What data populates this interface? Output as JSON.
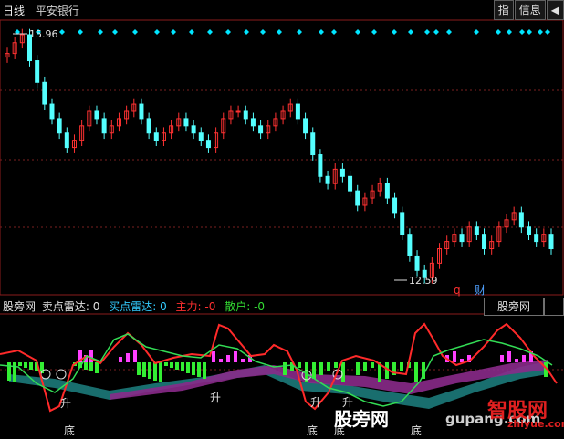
{
  "header": {
    "title": "日线",
    "stock": "平安银行"
  },
  "toolbar": {
    "btn_index": "指",
    "btn_info": "信息",
    "btn_nav": "◀"
  },
  "price": {
    "max_label": "15.96",
    "min_label": "12.59",
    "marker_q": "q",
    "marker_cai": "财"
  },
  "indicator": {
    "name": "股旁网",
    "sell_label": "卖点雷达:",
    "sell_value": "0",
    "buy_label": "买点雷达:",
    "buy_value": "0",
    "main_label": "主力:",
    "main_value": "-0",
    "retail_label": "散户:",
    "retail_value": "-0",
    "tab_label": "股旁网"
  },
  "signals": {
    "up": "升",
    "bottom": "底"
  },
  "watermark": {
    "main": "股旁网",
    "url": "gupang.com",
    "brand": "智股网",
    "brand_url": "zhiyue.com"
  },
  "colors": {
    "up": "#ff3232",
    "down": "#54ffff",
    "grid": "#7a1f1f",
    "diamond": "#00e5ff",
    "green_bar": "#33ee33",
    "magenta_bar": "#ff40ff",
    "main_line": "#ff2a2a",
    "retail_line": "#33dd55",
    "teal_area": "#1aa8a8",
    "purple_area": "#8a2a8a"
  },
  "chart_data": {
    "type": "candlestick",
    "title": "平安银行 日线",
    "ymax_label": 15.96,
    "ymin_label": 12.59,
    "closes": [
      15.7,
      15.85,
      15.96,
      15.6,
      15.3,
      15.0,
      14.8,
      14.6,
      14.4,
      14.5,
      14.7,
      14.9,
      14.8,
      14.6,
      14.7,
      14.8,
      14.9,
      15.0,
      14.8,
      14.6,
      14.5,
      14.6,
      14.7,
      14.8,
      14.7,
      14.6,
      14.5,
      14.4,
      14.6,
      14.8,
      14.9,
      14.9,
      14.8,
      14.7,
      14.6,
      14.7,
      14.8,
      14.9,
      15.0,
      14.8,
      14.6,
      14.3,
      14.0,
      13.9,
      14.1,
      14.0,
      13.8,
      13.6,
      13.7,
      13.8,
      13.9,
      13.7,
      13.5,
      13.2,
      12.9,
      12.7,
      12.6,
      12.8,
      13.0,
      13.1,
      13.2,
      13.1,
      13.3,
      13.2,
      13.0,
      13.1,
      13.3,
      13.4,
      13.5,
      13.3,
      13.2,
      13.1,
      13.2,
      13.0
    ]
  }
}
